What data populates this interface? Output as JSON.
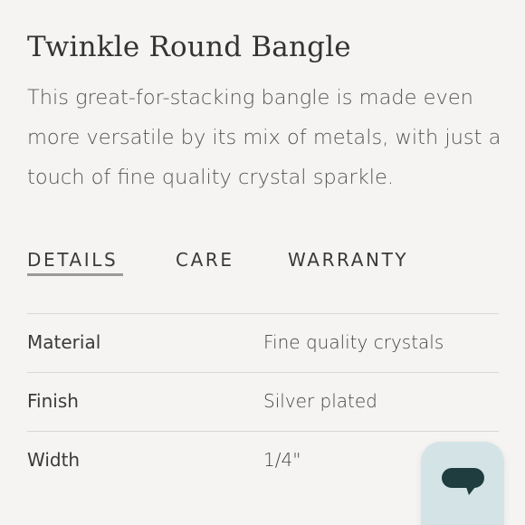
{
  "product": {
    "title": "Twinkle Round Bangle",
    "description": "This great-for-stacking bangle is made even more versatile by its mix of metals, with just a touch of fine quality crystal sparkle."
  },
  "tabs": [
    {
      "label": "DETAILS",
      "active": true
    },
    {
      "label": "CARE",
      "active": false
    },
    {
      "label": "WARRANTY",
      "active": false
    }
  ],
  "specs": [
    {
      "label": "Material",
      "value": "Fine quality crystals"
    },
    {
      "label": "Finish",
      "value": "Silver plated"
    },
    {
      "label": "Width",
      "value": "1/4\""
    }
  ],
  "chat_widget": {
    "icon": "chat-bubble-icon",
    "background_color": "#d4e3e6",
    "icon_color": "#1f3d3f"
  }
}
